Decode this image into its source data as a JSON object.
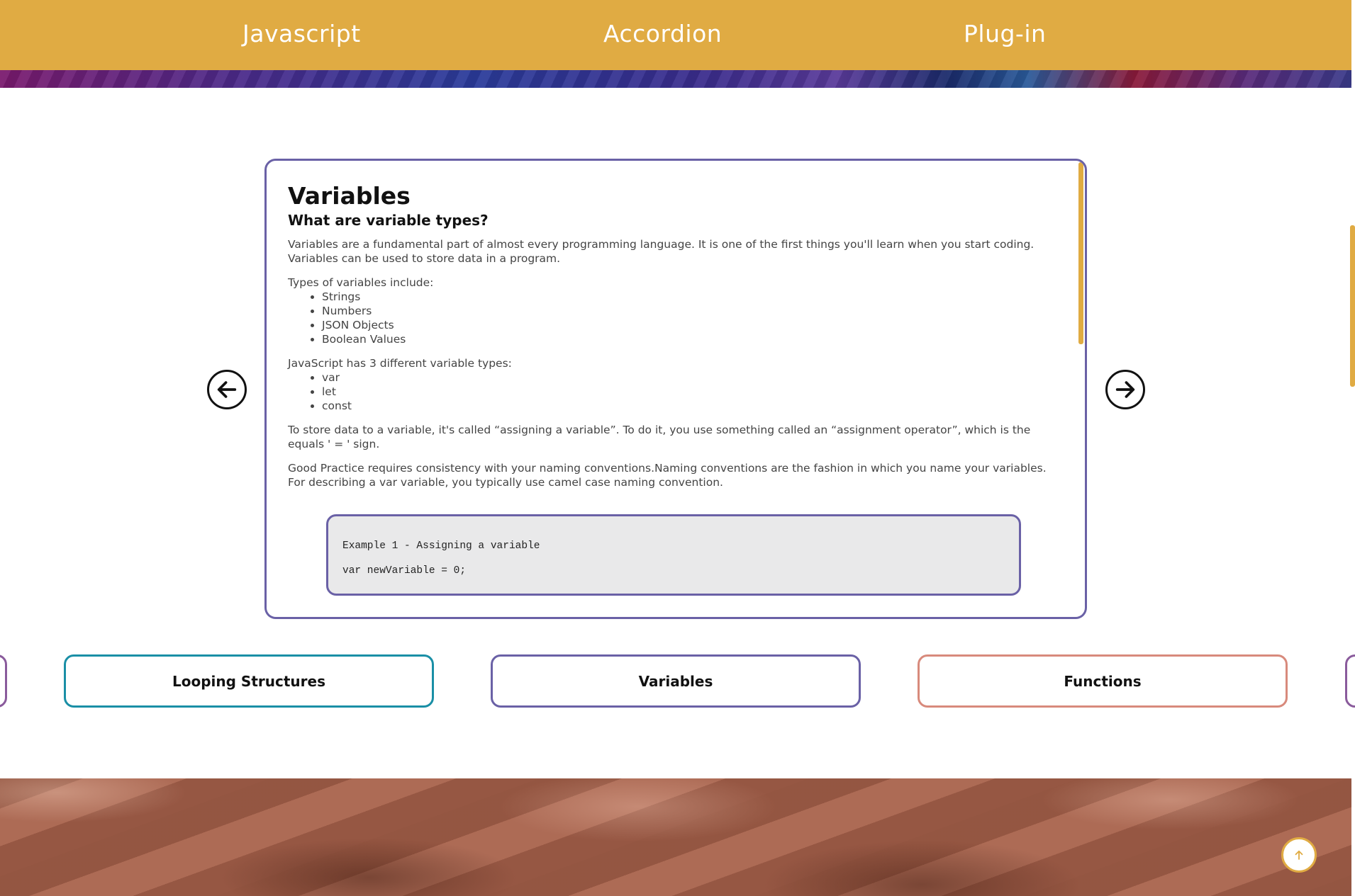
{
  "nav": {
    "items": [
      {
        "label": "Javascript"
      },
      {
        "label": "Accordion"
      },
      {
        "label": "Plug-in"
      }
    ]
  },
  "card": {
    "title": "Variables",
    "subtitle": "What are variable types?",
    "intro": "Variables are a fundamental part of almost every programming language. It is one of the first things you'll learn when you start coding. Variables can be used to store data in a program.",
    "types_intro": "Types of variables include:",
    "types": [
      "Strings",
      "Numbers",
      "JSON Objects",
      "Boolean Values"
    ],
    "js_intro": "JavaScript has 3 different variable types:",
    "js_types": [
      "var",
      "let",
      "const"
    ],
    "assign_text": "To store data to a variable, it's called “assigning a variable”. To do it, you use something called an “assignment operator”, which is the equals ' = ' sign.",
    "practice_text": "Good Practice requires consistency with your naming conventions.Naming conventions are the fashion in which you name your variables. For describing a var variable, you typically use camel case naming convention.",
    "code": {
      "line1": "Example 1 - Assigning a variable",
      "line2": "var newVariable = 0;"
    }
  },
  "tabs": [
    {
      "label": "Looping Structures",
      "color": "#1a8fa6"
    },
    {
      "label": "Variables",
      "color": "#6a61a6"
    },
    {
      "label": "Functions",
      "color": "#d88a7c"
    }
  ],
  "colors": {
    "header": "#e0ab43",
    "accent_purple": "#6a61a6"
  },
  "icons": {
    "prev": "arrow-left-circle-icon",
    "next": "arrow-right-circle-icon",
    "to_top": "arrow-up-icon"
  }
}
